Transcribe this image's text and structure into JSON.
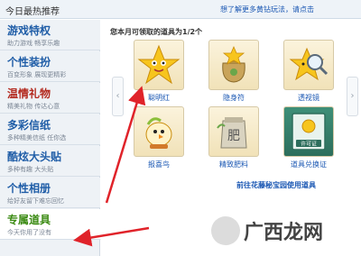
{
  "header": {
    "title": "今日最热推荐",
    "link": "想了解更多黄钻玩法，请点击"
  },
  "sidebar": {
    "items": [
      {
        "name": "游戏特权",
        "desc": "助力游戏 畅享乐趣",
        "style": "blue"
      },
      {
        "name": "个性装扮",
        "desc": "百变形象 展现更精彩",
        "style": "blue"
      },
      {
        "name": "温情礼物",
        "desc": "精美礼物 传达心意",
        "style": "red"
      },
      {
        "name": "多彩信纸",
        "desc": "多种精美信纸 任你选",
        "style": "blue"
      },
      {
        "name": "酷炫大头贴",
        "desc": "多种有趣 大头贴",
        "style": "blue"
      },
      {
        "name": "个性相册",
        "desc": "给好友留下难忘回忆",
        "style": "blue"
      },
      {
        "name": "专属道具",
        "desc": "今天你用了没有",
        "style": "active"
      }
    ]
  },
  "main": {
    "heading": "您本月可领取的道具为1/2个",
    "prev_arrow": "‹",
    "next_arrow": "›",
    "items": [
      {
        "label": "聪明红",
        "icon": "star-mascot-icon"
      },
      {
        "label": "隐身符",
        "icon": "moneybag-star-icon"
      },
      {
        "label": "透视镜",
        "icon": "magnifier-star-icon"
      },
      {
        "label": "报喜鸟",
        "icon": "bird-icon"
      },
      {
        "label": "精致肥料",
        "icon": "fertilizer-bag-icon"
      },
      {
        "label": "道具兑换证",
        "icon": "certificate-icon"
      }
    ],
    "bottom_link": "前往花藤秘宝园使用道具",
    "tile_badge": "许可证",
    "bag_text": "肥"
  },
  "watermark": {
    "text": "广西龙网"
  },
  "colors": {
    "annotation_arrow": "#e0232a",
    "link": "#1a57b3",
    "sidebar_text": "#1f5da7"
  }
}
